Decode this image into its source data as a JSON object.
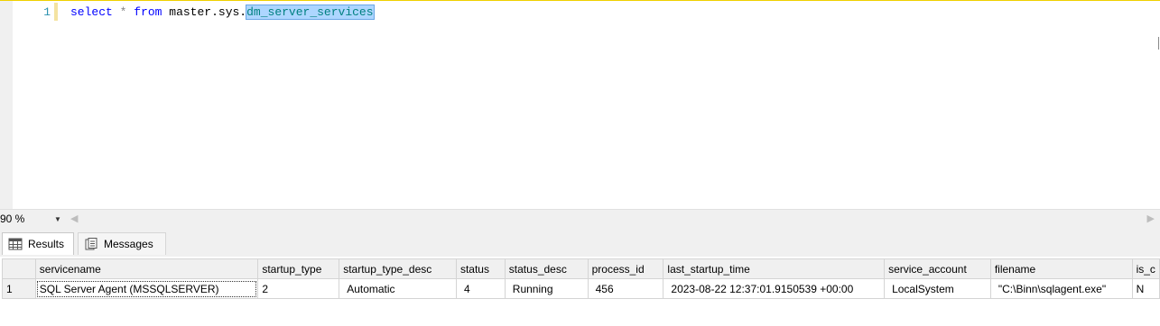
{
  "editor": {
    "line_number": "1",
    "code_keyword_select": "select",
    "code_star": "*",
    "code_keyword_from": "from",
    "code_object_prefix": "master.sys.",
    "code_object_selected": "dm_server_services"
  },
  "zoom": {
    "value": "90 %"
  },
  "tabs": [
    {
      "label": "Results",
      "icon": "grid-icon",
      "active": true
    },
    {
      "label": "Messages",
      "icon": "messages-icon",
      "active": false
    }
  ],
  "grid": {
    "columns": [
      "servicename",
      "startup_type",
      "startup_type_desc",
      "status",
      "status_desc",
      "process_id",
      "last_startup_time",
      "service_account",
      "filename",
      "is_c"
    ],
    "rows": [
      {
        "rownum": "1",
        "cells": [
          "SQL Server Agent (MSSQLSERVER)",
          "2",
          "Automatic",
          "4",
          "Running",
          "456",
          "2023-08-22 12:37:01.9150539 +00:00",
          "LocalSystem",
          "\"C:\\Binn\\sqlagent.exe\"",
          "N"
        ]
      }
    ]
  },
  "colors": {
    "keyword": "#0000ff",
    "object": "#008080",
    "selection": "#add6ff",
    "line_number": "#2b91af"
  }
}
